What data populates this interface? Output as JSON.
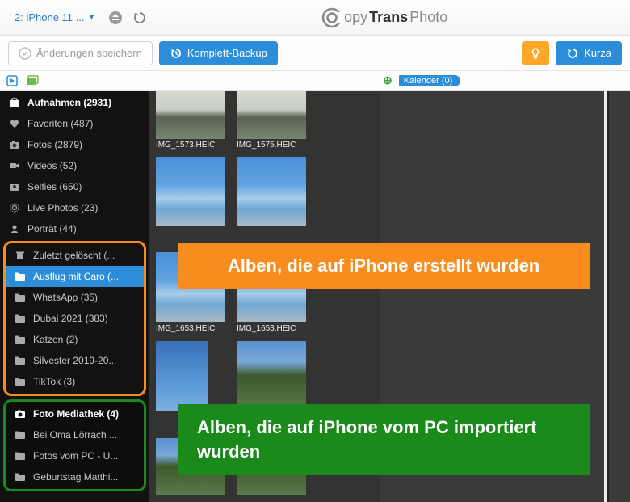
{
  "titlebar": {
    "device": "2: iPhone 11 ...",
    "app_name_1": "opy",
    "app_name_2": "Trans",
    "app_name_3": " Photo"
  },
  "toolbar": {
    "save": "Änderungen speichern",
    "backup": "Komplett-Backup",
    "short": "Kurza"
  },
  "albums": {
    "aufnahmen": "Aufnahmen (2931)",
    "favoriten": "Favoriten (487)",
    "fotos": "Fotos (2879)",
    "videos": "Videos (52)",
    "selfies": "Selfies (650)",
    "livephotos": "Live Photos (23)",
    "portrait": "Porträt (44)",
    "zuletzt": "Zuletzt gelöscht (...",
    "ausflug": "Ausflug mit Caro (...",
    "whatsapp": "WhatsApp (35)",
    "dubai": "Dubai 2021 (383)",
    "katzen": "Katzen  (2)",
    "silvester": "Silvester 2019-20...",
    "tiktok": "TikTok (3)",
    "mediathek": "Foto Mediathek (4)",
    "beioma": "Bei Oma Lörrach ...",
    "fotospc": "Fotos vom PC - U...",
    "geburtstag": "Geburtstag Matthi..."
  },
  "thumbs": {
    "f1": "IMG_1573.HEIC",
    "f2": "IMG_1575.HEIC",
    "f3": "IMG_1653.HEIC",
    "f4": "IMG_1653.HEIC"
  },
  "right": {
    "kalender": "Kalender (0)"
  },
  "callouts": {
    "orange": "Alben, die auf iPhone erstellt wurden",
    "green": "Alben, die auf iPhone vom PC importiert wurden"
  }
}
